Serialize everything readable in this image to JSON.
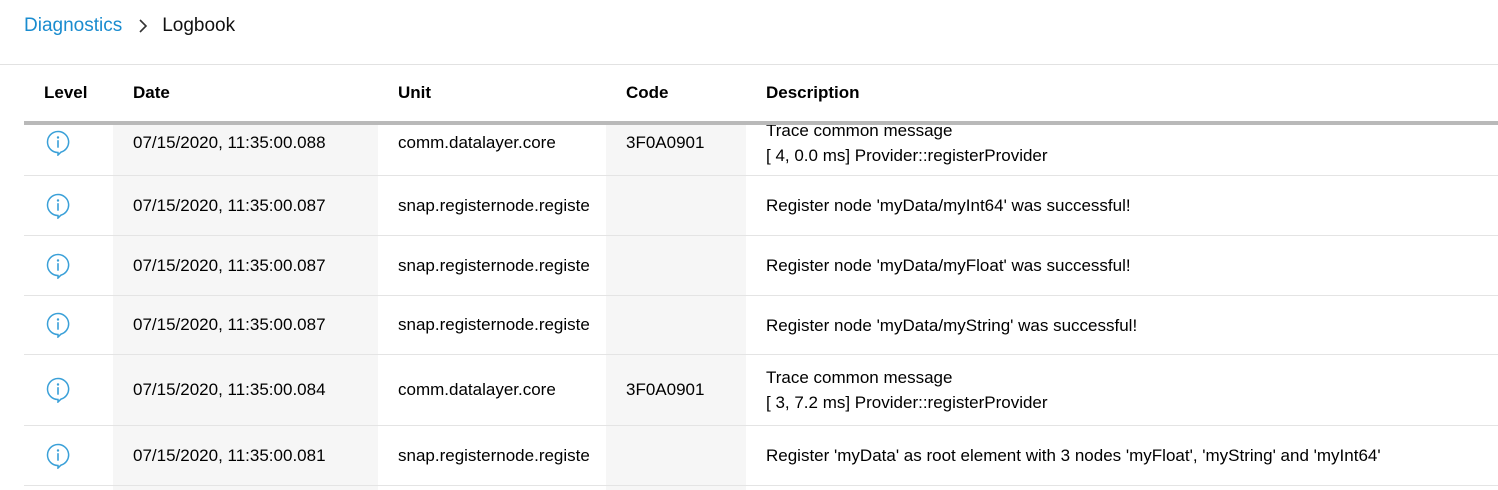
{
  "breadcrumb": {
    "parent": "Diagnostics",
    "current": "Logbook"
  },
  "table": {
    "headers": {
      "level": "Level",
      "date": "Date",
      "unit": "Unit",
      "code": "Code",
      "description": "Description"
    },
    "rows": [
      {
        "level_icon": "info-icon",
        "date": "07/15/2020, 11:35:00.088",
        "unit": "comm.datalayer.core",
        "code": "3F0A0901",
        "description_line1": "Trace common message",
        "description_line2": "[ 4, 0.0 ms] Provider::registerProvider"
      },
      {
        "level_icon": "info-icon",
        "date": "07/15/2020, 11:35:00.087",
        "unit": "snap.registernode.registe",
        "code": "",
        "description_line1": "Register node 'myData/myInt64' was successful!",
        "description_line2": ""
      },
      {
        "level_icon": "info-icon",
        "date": "07/15/2020, 11:35:00.087",
        "unit": "snap.registernode.registe",
        "code": "",
        "description_line1": "Register node 'myData/myFloat' was successful!",
        "description_line2": ""
      },
      {
        "level_icon": "info-icon",
        "date": "07/15/2020, 11:35:00.087",
        "unit": "snap.registernode.registe",
        "code": "",
        "description_line1": "Register node 'myData/myString' was successful!",
        "description_line2": ""
      },
      {
        "level_icon": "info-icon",
        "date": "07/15/2020, 11:35:00.084",
        "unit": "comm.datalayer.core",
        "code": "3F0A0901",
        "description_line1": "Trace common message",
        "description_line2": "[ 3, 7.2 ms] Provider::registerProvider"
      },
      {
        "level_icon": "info-icon",
        "date": "07/15/2020, 11:35:00.081",
        "unit": "snap.registernode.registe",
        "code": "",
        "description_line1": "Register 'myData' as root element with 3 nodes 'myFloat', 'myString' and 'myInt64'",
        "description_line2": ""
      }
    ]
  },
  "colors": {
    "link": "#1a8ccf",
    "info_icon": "#3aa0d8",
    "alt_column": "#f6f6f6"
  }
}
